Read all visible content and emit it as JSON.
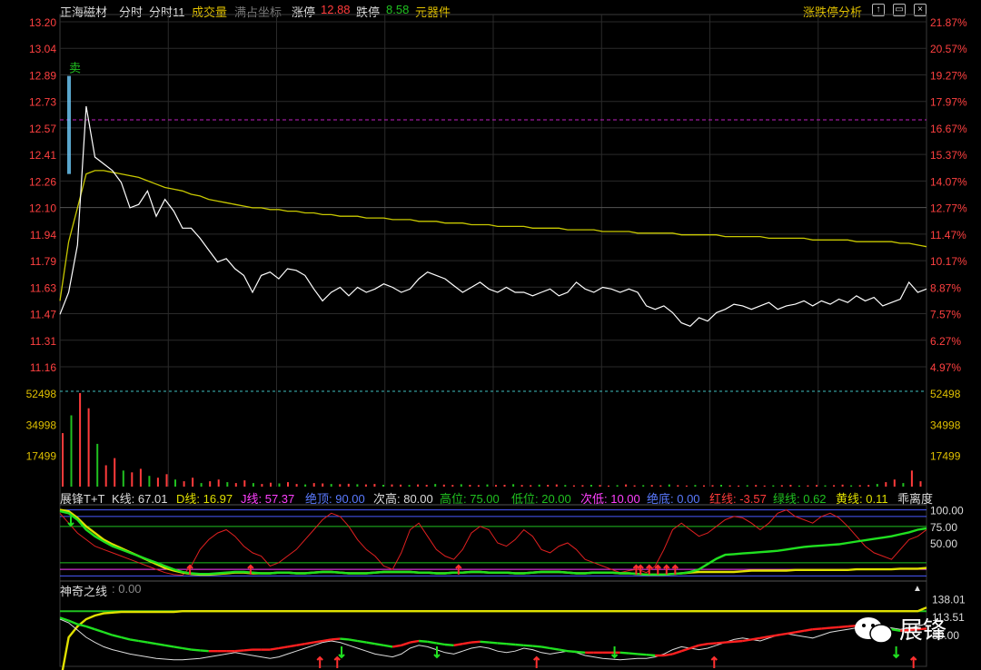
{
  "header": {
    "stock_name": "正海磁材",
    "tab_fenshi": "分时",
    "tab_fenshi11": "分时11",
    "volume_label": "成交量",
    "full_axis_label": "满占坐标",
    "limit_up_label": "涨停",
    "limit_up_value": "12.88",
    "limit_down_label": "跌停",
    "limit_down_value": "8.58",
    "sector": "元器件",
    "analysis_button": "涨跌停分析",
    "icons": [
      "expand-icon",
      "restore-icon",
      "close-icon"
    ]
  },
  "colors": {
    "price_line": "#ffffff",
    "avg_line": "#c8c800",
    "up": "#ff3b3b",
    "down": "#20c020",
    "grid": "#2a2a2a",
    "left_axis": "#ff4040",
    "right_axis": "#ff4040"
  },
  "chart_data": [
    {
      "type": "line",
      "title": "",
      "left_ticks": [
        "13.20",
        "13.04",
        "12.89",
        "12.73",
        "12.57",
        "12.41",
        "12.26",
        "12.10",
        "11.94",
        "11.79",
        "11.63",
        "11.47",
        "11.31",
        "11.16"
      ],
      "right_ticks": [
        "21.87%",
        "20.57%",
        "19.27%",
        "17.97%",
        "16.67%",
        "15.37%",
        "14.07%",
        "12.77%",
        "11.47%",
        "10.17%",
        "8.87%",
        "7.57%",
        "6.27%",
        "4.97%"
      ],
      "ylim": [
        11.16,
        13.2
      ],
      "limit_line": 12.62,
      "annotation": "卖",
      "series": [
        {
          "values": [
            11.47,
            11.6,
            11.88,
            12.7,
            12.4,
            12.36,
            12.32,
            12.25,
            12.1,
            12.12,
            12.2,
            12.05,
            12.15,
            12.08,
            11.98,
            11.98,
            11.92,
            11.85,
            11.78,
            11.8,
            11.74,
            11.7,
            11.6,
            11.7,
            11.72,
            11.68,
            11.74,
            11.73,
            11.7,
            11.62,
            11.55,
            11.6,
            11.63,
            11.58,
            11.63,
            11.6,
            11.62,
            11.65,
            11.63,
            11.6,
            11.62,
            11.68,
            11.72,
            11.7,
            11.68,
            11.64,
            11.6,
            11.63,
            11.66,
            11.62,
            11.6,
            11.63,
            11.6,
            11.6,
            11.58,
            11.6,
            11.62,
            11.58,
            11.6,
            11.66,
            11.62,
            11.6,
            11.63,
            11.62,
            11.6,
            11.62,
            11.6,
            11.52,
            11.5,
            11.52,
            11.48,
            11.42,
            11.4,
            11.45,
            11.43,
            11.48,
            11.5,
            11.53,
            11.52,
            11.5,
            11.52,
            11.54,
            11.5,
            11.52,
            11.53,
            11.55,
            11.52,
            11.55,
            11.53,
            11.56,
            11.54,
            11.58,
            11.55,
            11.57,
            11.52,
            11.54,
            11.56,
            11.66,
            11.6,
            11.62
          ]
        },
        {
          "values": [
            11.55,
            11.9,
            12.1,
            12.3,
            12.32,
            12.32,
            12.31,
            12.3,
            12.29,
            12.28,
            12.26,
            12.24,
            12.22,
            12.21,
            12.2,
            12.18,
            12.17,
            12.15,
            12.14,
            12.13,
            12.12,
            12.11,
            12.1,
            12.1,
            12.09,
            12.09,
            12.08,
            12.08,
            12.07,
            12.07,
            12.06,
            12.06,
            12.05,
            12.05,
            12.05,
            12.04,
            12.04,
            12.04,
            12.03,
            12.03,
            12.03,
            12.02,
            12.02,
            12.02,
            12.01,
            12.01,
            12.01,
            12.0,
            12.0,
            12.0,
            11.99,
            11.99,
            11.99,
            11.99,
            11.98,
            11.98,
            11.98,
            11.98,
            11.97,
            11.97,
            11.97,
            11.97,
            11.96,
            11.96,
            11.96,
            11.96,
            11.95,
            11.95,
            11.95,
            11.95,
            11.95,
            11.94,
            11.94,
            11.94,
            11.94,
            11.94,
            11.93,
            11.93,
            11.93,
            11.93,
            11.93,
            11.92,
            11.92,
            11.92,
            11.92,
            11.92,
            11.91,
            11.91,
            11.91,
            11.91,
            11.91,
            11.9,
            11.9,
            11.9,
            11.9,
            11.9,
            11.89,
            11.89,
            11.88,
            11.87
          ]
        }
      ]
    },
    {
      "type": "bar",
      "ticks": [
        "52498",
        "34998",
        "17499"
      ],
      "ylim": [
        0,
        52498
      ],
      "values": [
        30000,
        40000,
        52498,
        44000,
        24000,
        12000,
        16000,
        9000,
        8000,
        10000,
        6000,
        5000,
        7000,
        4000,
        3000,
        5000,
        2000,
        3000,
        4000,
        2500,
        2000,
        3500,
        2000,
        1500,
        2200,
        1800,
        2500,
        1500,
        1200,
        2000,
        1800,
        1500,
        1400,
        1600,
        1300,
        1200,
        1500,
        1000,
        1200,
        1100,
        900,
        1200,
        1000,
        1500,
        1100,
        900,
        1300,
        1000,
        800,
        1200,
        900,
        1000,
        1400,
        900,
        800,
        1100,
        1000,
        1200,
        900,
        700,
        800,
        1000,
        900,
        600,
        800,
        1200,
        700,
        800,
        900,
        700,
        1200,
        800,
        600,
        900,
        700,
        800,
        1000,
        700,
        600,
        800,
        900,
        600,
        700,
        800,
        1000,
        600,
        700,
        900,
        700,
        800,
        1100,
        700,
        800,
        900,
        1500,
        2500,
        4000,
        2000,
        9000,
        3000
      ]
    },
    {
      "type": "line",
      "title": "展锋T+T",
      "ticks": [
        "100.00",
        "75.00",
        "50.00"
      ],
      "ylim": [
        -5,
        105
      ],
      "series": [
        {
          "values": [
            98,
            95,
            85,
            70,
            60,
            52,
            45,
            40,
            35,
            30,
            25,
            20,
            15,
            10,
            6,
            4,
            3,
            3,
            4,
            5,
            6,
            6,
            5,
            4,
            4,
            5,
            5,
            4,
            4,
            5,
            6,
            6,
            5,
            4,
            4,
            4,
            5,
            6,
            6,
            6,
            6,
            5,
            5,
            4,
            4,
            5,
            5,
            6,
            6,
            5,
            5,
            5,
            4,
            4,
            5,
            6,
            6,
            6,
            5,
            4,
            4,
            5,
            5,
            5,
            4,
            4,
            3,
            2,
            2,
            2,
            3,
            4,
            6,
            10,
            18,
            26,
            32,
            33,
            34,
            35,
            36,
            37,
            38,
            40,
            42,
            44,
            45,
            46,
            47,
            48,
            50,
            52,
            54,
            56,
            58,
            60,
            63,
            66,
            70,
            72
          ]
        },
        {
          "values": [
            100,
            98,
            88,
            75,
            65,
            55,
            48,
            42,
            36,
            30,
            24,
            18,
            12,
            8,
            5,
            3,
            2,
            2,
            3,
            4,
            5,
            5,
            4,
            4,
            4,
            5,
            5,
            4,
            4,
            5,
            6,
            6,
            5,
            4,
            4,
            4,
            5,
            6,
            6,
            6,
            6,
            5,
            5,
            4,
            4,
            5,
            5,
            6,
            6,
            5,
            5,
            5,
            4,
            4,
            5,
            6,
            6,
            6,
            5,
            4,
            4,
            5,
            5,
            5,
            4,
            4,
            3,
            2,
            2,
            2,
            3,
            4,
            5,
            6,
            6,
            6,
            6,
            6,
            7,
            8,
            8,
            8,
            8,
            8,
            9,
            9,
            9,
            9,
            9,
            9,
            9,
            10,
            10,
            10,
            10,
            10,
            11,
            11,
            11,
            12
          ]
        },
        {
          "values": [
            95,
            80,
            65,
            55,
            45,
            40,
            35,
            30,
            25,
            20,
            15,
            10,
            5,
            2,
            1,
            15,
            40,
            55,
            65,
            70,
            60,
            45,
            35,
            30,
            15,
            20,
            30,
            40,
            55,
            70,
            85,
            95,
            90,
            75,
            55,
            40,
            30,
            15,
            10,
            35,
            70,
            80,
            60,
            40,
            30,
            25,
            40,
            65,
            75,
            70,
            50,
            45,
            55,
            70,
            60,
            40,
            35,
            45,
            50,
            40,
            25,
            20,
            15,
            10,
            5,
            8,
            10,
            5,
            15,
            40,
            70,
            80,
            70,
            60,
            65,
            75,
            85,
            90,
            88,
            80,
            70,
            80,
            95,
            100,
            90,
            85,
            80,
            90,
            95,
            88,
            75,
            60,
            45,
            35,
            30,
            25,
            40,
            55,
            60,
            70
          ]
        }
      ]
    },
    {
      "type": "line",
      "title": "神奇之线",
      "ticks": [
        "138.01",
        "113.51",
        "89.00"
      ],
      "series": [
        {
          "values": [
            20,
            85,
            100,
            110,
            115,
            118,
            119,
            120,
            120,
            120,
            120,
            120,
            120,
            120,
            121,
            121,
            121,
            121,
            121,
            121,
            121,
            121,
            121,
            121,
            121,
            121,
            121,
            121,
            121,
            121,
            121,
            121,
            121,
            121,
            121,
            121,
            121,
            121,
            121,
            121,
            121,
            121,
            121,
            121,
            121,
            121,
            121,
            121,
            121,
            121,
            121,
            121,
            121,
            121,
            121,
            121,
            121,
            121,
            121,
            121,
            121,
            121,
            121,
            121,
            121,
            121,
            121,
            121,
            121,
            121,
            121,
            121,
            121,
            121,
            121,
            121,
            121,
            121,
            121,
            121,
            121,
            121,
            121,
            121,
            121,
            121,
            121,
            121,
            121,
            121,
            121,
            121,
            121,
            121,
            121,
            121,
            121,
            121,
            121,
            126
          ]
        },
        {
          "values": [
            112,
            108,
            103,
            100,
            96,
            92,
            88,
            85,
            82,
            80,
            78,
            76,
            74,
            72,
            70,
            68,
            67,
            66,
            66,
            66,
            66,
            67,
            68,
            68,
            68,
            70,
            72,
            74,
            76,
            78,
            80,
            82,
            83,
            82,
            80,
            78,
            76,
            74,
            72,
            74,
            78,
            80,
            79,
            77,
            75,
            74,
            76,
            78,
            79,
            78,
            77,
            76,
            75,
            74,
            73,
            72,
            70,
            68,
            66,
            65,
            64,
            64,
            64,
            64,
            64,
            63,
            62,
            61,
            60,
            60,
            62,
            66,
            70,
            74,
            76,
            77,
            78,
            79,
            80,
            82,
            84,
            86,
            88,
            90,
            92,
            94,
            96,
            97,
            98,
            99,
            100,
            101,
            100,
            99,
            98,
            96,
            94,
            95,
            96,
            97
          ]
        },
        {
          "values": [
            110,
            105,
            95,
            85,
            78,
            72,
            68,
            65,
            62,
            60,
            58,
            56,
            55,
            54,
            54,
            55,
            56,
            58,
            60,
            62,
            64,
            62,
            60,
            58,
            56,
            58,
            62,
            66,
            70,
            74,
            78,
            80,
            78,
            74,
            70,
            66,
            62,
            60,
            58,
            62,
            70,
            74,
            72,
            68,
            64,
            62,
            66,
            70,
            72,
            70,
            66,
            64,
            66,
            70,
            68,
            64,
            62,
            64,
            66,
            64,
            60,
            58,
            56,
            55,
            54,
            55,
            56,
            56,
            58,
            62,
            68,
            72,
            70,
            68,
            70,
            74,
            78,
            82,
            84,
            82,
            80,
            84,
            88,
            90,
            88,
            86,
            84,
            88,
            92,
            94,
            96,
            98,
            100,
            102,
            100,
            98,
            96,
            98,
            100,
            104
          ]
        }
      ]
    }
  ],
  "kdj_header": {
    "name": "展锋T+T",
    "k": "K线: 67.01",
    "d": "D线: 16.97",
    "j": "J线: 57.37",
    "abs_top": "绝顶: 90.00",
    "sub_high": "次高: 80.00",
    "high": "高位: 75.00",
    "low": "低位: 20.00",
    "sub_low": "次低: 10.00",
    "abs_bottom": "绝底: 0.00",
    "red_line": "红线: -3.57",
    "green_line": "绿线: 0.62",
    "yellow_line": "黄线: 0.11",
    "last": "乖离度"
  },
  "magic_header": {
    "name": "神奇之线",
    "value": ": 0.00"
  },
  "watermark": "展锋"
}
